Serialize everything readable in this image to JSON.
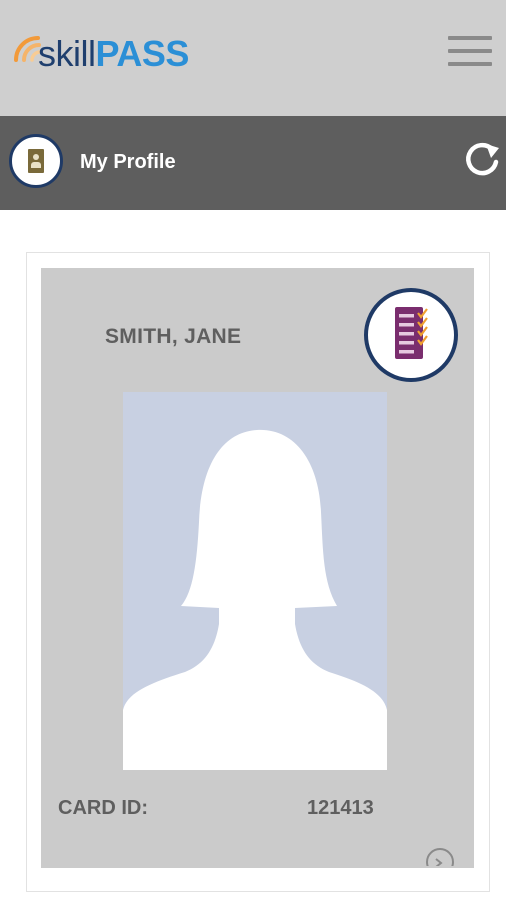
{
  "header": {
    "logo_part1": "skill",
    "logo_part2": "PASS",
    "menu_icon": "hamburger-menu-icon"
  },
  "profile_bar": {
    "title": "My Profile",
    "avatar_icon": "profile-card-icon",
    "refresh_icon": "refresh-icon"
  },
  "card": {
    "name": "SMITH, JANE",
    "card_id_label": "CARD ID:",
    "card_id_value": "121413",
    "checklist_icon": "checklist-icon",
    "photo_icon": "person-silhouette-icon"
  },
  "colors": {
    "topbar": "#cfcfcf",
    "profile_bar": "#5e5e5e",
    "card": "#cbcbcb",
    "photo_bg": "#c8d0e2",
    "accent_navy": "#1f3a66",
    "logo_blue": "#2b8fd6",
    "logo_orange": "#f29a3a",
    "checklist_purple": "#7a2d6e"
  }
}
